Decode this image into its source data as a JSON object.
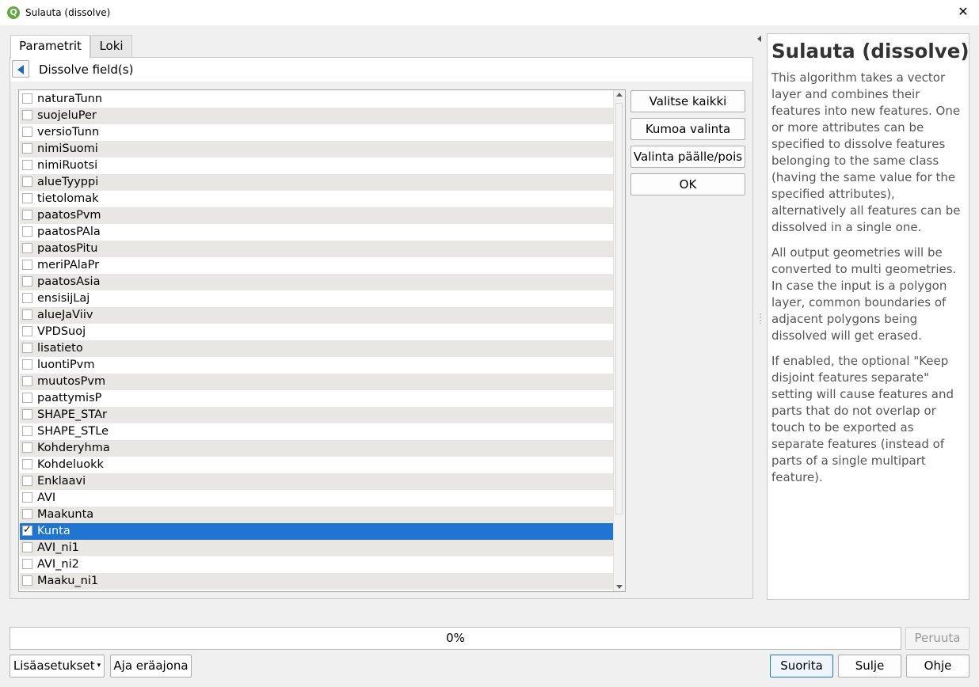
{
  "window": {
    "title": "Sulauta (dissolve)",
    "app_icon_glyph": "Q",
    "close_glyph": "✕"
  },
  "tabs": [
    {
      "label": "Parametrit",
      "active": true
    },
    {
      "label": "Loki",
      "active": false
    }
  ],
  "nav": {
    "title": "Dissolve field(s)"
  },
  "fields": [
    {
      "label": "naturaTunn",
      "checked": false
    },
    {
      "label": "suojeluPer",
      "checked": false
    },
    {
      "label": "versioTunn",
      "checked": false
    },
    {
      "label": "nimiSuomi",
      "checked": false
    },
    {
      "label": "nimiRuotsi",
      "checked": false
    },
    {
      "label": "alueTyyppi",
      "checked": false
    },
    {
      "label": "tietolomak",
      "checked": false
    },
    {
      "label": "paatosPvm",
      "checked": false
    },
    {
      "label": "paatosPAla",
      "checked": false
    },
    {
      "label": "paatosPitu",
      "checked": false
    },
    {
      "label": "meriPAlaPr",
      "checked": false
    },
    {
      "label": "paatosAsia",
      "checked": false
    },
    {
      "label": "ensisijLaj",
      "checked": false
    },
    {
      "label": "alueJaViiv",
      "checked": false
    },
    {
      "label": "VPDSuoj",
      "checked": false
    },
    {
      "label": "lisatieto",
      "checked": false
    },
    {
      "label": "luontiPvm",
      "checked": false
    },
    {
      "label": "muutosPvm",
      "checked": false
    },
    {
      "label": "paattymisP",
      "checked": false
    },
    {
      "label": "SHAPE_STAr",
      "checked": false
    },
    {
      "label": "SHAPE_STLe",
      "checked": false
    },
    {
      "label": "Kohderyhma",
      "checked": false
    },
    {
      "label": "Kohdeluokk",
      "checked": false
    },
    {
      "label": "Enklaavi",
      "checked": false
    },
    {
      "label": "AVI",
      "checked": false
    },
    {
      "label": "Maakunta",
      "checked": false
    },
    {
      "label": "Kunta",
      "checked": true
    },
    {
      "label": "AVI_ni1",
      "checked": false
    },
    {
      "label": "AVI_ni2",
      "checked": false
    },
    {
      "label": "Maaku_ni1",
      "checked": false
    }
  ],
  "side_buttons": {
    "select_all": "Valitse kaikki",
    "clear_selection": "Kumoa valinta",
    "toggle_selection": "Valinta päälle/pois",
    "ok": "OK"
  },
  "help": {
    "title": "Sulauta (dissolve)",
    "paragraphs": [
      "This algorithm takes a vector layer and combines their features into new features. One or more attributes can be specified to dissolve features belonging to the same class (having the same value for the specified attributes), alternatively all features can be dissolved in a single one.",
      "All output geometries will be converted to multi geometries. In case the input is a polygon layer, common boundaries of adjacent polygons being dissolved will get erased.",
      "If enabled, the optional \"Keep disjoint features separate\" setting will cause features and parts that do not overlap or touch to be exported as separate features (instead of parts of a single multipart feature)."
    ]
  },
  "progress": {
    "value": 0,
    "label": "0%"
  },
  "footer": {
    "cancel": "Peruuta",
    "advanced": "Lisäasetukset",
    "batch": "Aja eräajona",
    "run": "Suorita",
    "close": "Sulje",
    "help": "Ohje"
  },
  "colors": {
    "selection": "#1f75cf",
    "alt_row": "#e9e7e3",
    "accent": "#1f68b5"
  }
}
